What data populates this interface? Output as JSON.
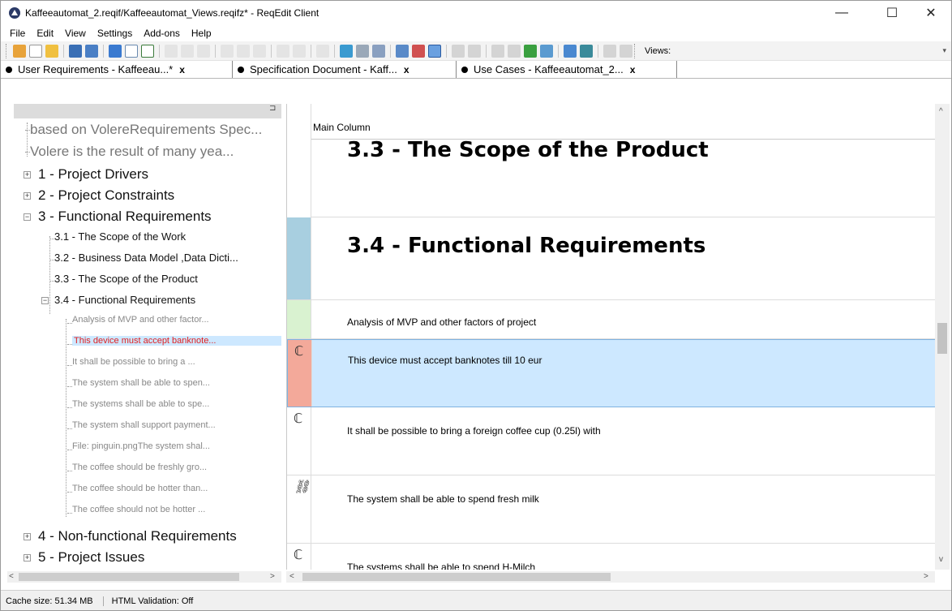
{
  "window": {
    "title": "Kaffeeautomat_2.reqif/Kaffeeautomat_Views.reqifz* - ReqEdit Client",
    "minimize": "—",
    "maximize": "☐",
    "close": "✕"
  },
  "menu": [
    "File",
    "Edit",
    "View",
    "Settings",
    "Add-ons",
    "Help"
  ],
  "toolbar": {
    "views_label": "Views:",
    "overflow": "▾"
  },
  "tabs": [
    {
      "label": "User Requirements - Kaffeeau...*",
      "close": "x"
    },
    {
      "label": "Specification Document - Kaff...",
      "close": "x"
    },
    {
      "label": "Use Cases - Kaffeeautomat_2...",
      "close": "x"
    }
  ],
  "tree": {
    "pin": "⊐",
    "items": [
      {
        "label": "based on VolereRequirements Spec...",
        "level": 0
      },
      {
        "label": "Volere is the result of many yea...",
        "level": 0
      },
      {
        "label": "1 - Project Drivers",
        "level": 1,
        "expander": "+"
      },
      {
        "label": "2 - Project Constraints",
        "level": 1,
        "expander": "+"
      },
      {
        "label": "3 - Functional Requirements",
        "level": 1,
        "expander": "−"
      },
      {
        "label": "3.1 - The Scope of the Work",
        "level": 2
      },
      {
        "label": "3.2 - Business Data Model ,Data Dicti...",
        "level": 2
      },
      {
        "label": "3.3 - The Scope of the Product",
        "level": 2
      },
      {
        "label": "3.4 - Functional Requirements",
        "level": 2,
        "expander": "−"
      },
      {
        "label": "Analysis of MVP and other factor...",
        "level": 3
      },
      {
        "label": "This device must accept banknote...",
        "level": 3,
        "selected": true
      },
      {
        "label": "It shall be possible to bring a ...",
        "level": 3
      },
      {
        "label": "The system shall be able to spen...",
        "level": 3
      },
      {
        "label": "The systems shall be able to spe...",
        "level": 3
      },
      {
        "label": "The system shall support payment...",
        "level": 3
      },
      {
        "label": "File: pinguin.pngThe system shal...",
        "level": 3
      },
      {
        "label": "The coffee should be freshly gro...",
        "level": 3
      },
      {
        "label": "The coffee should be hotter than...",
        "level": 3
      },
      {
        "label": "The coffee should not be hotter ...",
        "level": 3
      },
      {
        "label": "4 - Non-functional Requirements",
        "level": 1,
        "expander": "+"
      },
      {
        "label": "5 - Project Issues",
        "level": 1,
        "expander": "+"
      }
    ]
  },
  "main": {
    "column_header": "Main Column",
    "rows": [
      {
        "text": "3.3 - The Scope of the Product",
        "kind": "heading",
        "gutter": "#ffffff"
      },
      {
        "text": "3.4 - Functional Requirements",
        "kind": "heading",
        "gutter": "#a8cfe0"
      },
      {
        "text": "Analysis of MVP and other factors of project",
        "kind": "body",
        "gutter": "#d9f2d0"
      },
      {
        "text": "This device must accept banknotes till 10 eur",
        "kind": "body",
        "gutter": "#f3a99a",
        "selected": true,
        "icon": "link-icon"
      },
      {
        "text": "It shall be possible to bring a foreign coffee cup (0.25l) with",
        "kind": "body",
        "gutter": "#ffffff",
        "icon": "link-icon"
      },
      {
        "text": "The system shall be able to spend fresh milk",
        "kind": "body",
        "gutter": "#ffffff",
        "icon": "link-multi-icon"
      },
      {
        "text": "The systems shall be able to spend H-Milch",
        "kind": "body",
        "gutter": "#ffffff",
        "icon": "link-icon"
      }
    ]
  },
  "status": {
    "cache": "Cache size:  51.34 MB",
    "validation": "HTML Validation: Off"
  },
  "colors": {
    "selection": "#cde8ff",
    "selected_tree_text": "#e02020",
    "heading_gutter_blue": "#a8cfe0",
    "green_gutter": "#d9f2d0",
    "red_gutter": "#f3a99a"
  }
}
